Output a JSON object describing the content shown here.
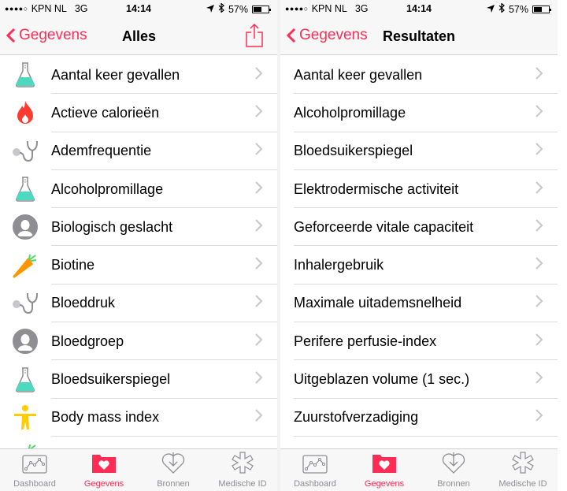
{
  "status": {
    "carrier": "KPN NL",
    "network": "3G",
    "time": "14:14",
    "battery": "57%",
    "battery_level": 0.57,
    "signal_dots": "●●●●○"
  },
  "left": {
    "back_label": "Gegevens",
    "title": "Alles",
    "items": [
      {
        "label": "Aantal keer gevallen",
        "icon": "flask-icon"
      },
      {
        "label": "Actieve calorieën",
        "icon": "flame-icon"
      },
      {
        "label": "Ademfrequentie",
        "icon": "stethoscope-icon"
      },
      {
        "label": "Alcoholpromillage",
        "icon": "flask-icon"
      },
      {
        "label": "Biologisch geslacht",
        "icon": "person-icon"
      },
      {
        "label": "Biotine",
        "icon": "carrot-icon"
      },
      {
        "label": "Bloeddruk",
        "icon": "stethoscope-icon"
      },
      {
        "label": "Bloedgroep",
        "icon": "person-icon"
      },
      {
        "label": "Bloedsuikerspiegel",
        "icon": "flask-icon"
      },
      {
        "label": "Body mass index",
        "icon": "body-icon"
      }
    ]
  },
  "right": {
    "back_label": "Gegevens",
    "title": "Resultaten",
    "items": [
      {
        "label": "Aantal keer gevallen"
      },
      {
        "label": "Alcoholpromillage"
      },
      {
        "label": "Bloedsuikerspiegel"
      },
      {
        "label": "Elektrodermische activiteit"
      },
      {
        "label": "Geforceerde vitale capaciteit"
      },
      {
        "label": "Inhalergebruik"
      },
      {
        "label": "Maximale uitademsnelheid"
      },
      {
        "label": "Perifere perfusie-index"
      },
      {
        "label": "Uitgeblazen volume (1 sec.)"
      },
      {
        "label": "Zuurstofverzadiging"
      }
    ]
  },
  "tabs": [
    {
      "label": "Dashboard",
      "icon": "dashboard-icon",
      "active": false
    },
    {
      "label": "Gegevens",
      "icon": "health-data-icon",
      "active": true
    },
    {
      "label": "Bronnen",
      "icon": "sources-icon",
      "active": false
    },
    {
      "label": "Medische ID",
      "icon": "medical-id-icon",
      "active": false
    }
  ],
  "colors": {
    "accent": "#ff2d55",
    "flask": "#4cd9c0",
    "flame": "#ff3b30",
    "carrot": "#ff9500",
    "body": "#ffcc00",
    "gray_icon": "#8e8e93"
  }
}
